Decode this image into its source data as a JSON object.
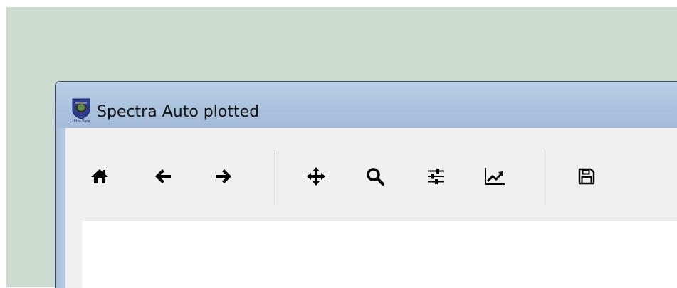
{
  "window": {
    "title": "Spectra Auto plotted",
    "app_icon": "ultra-pure-logo",
    "app_icon_text": "Ultra Pure"
  },
  "toolbar": {
    "buttons": [
      {
        "name": "home",
        "icon": "home-icon"
      },
      {
        "name": "back",
        "icon": "arrow-left-icon"
      },
      {
        "name": "forward",
        "icon": "arrow-right-icon"
      },
      {
        "name": "pan",
        "icon": "move-icon"
      },
      {
        "name": "zoom",
        "icon": "search-icon"
      },
      {
        "name": "configure-subplots",
        "icon": "sliders-icon"
      },
      {
        "name": "edit-axes",
        "icon": "line-chart-icon"
      },
      {
        "name": "save",
        "icon": "save-icon"
      }
    ]
  },
  "colors": {
    "desktop": "#ccdbcf",
    "titlebar": "#b3c9e2",
    "toolbar": "#f0f0f0",
    "canvas": "#ffffff",
    "icon": "#000000"
  }
}
